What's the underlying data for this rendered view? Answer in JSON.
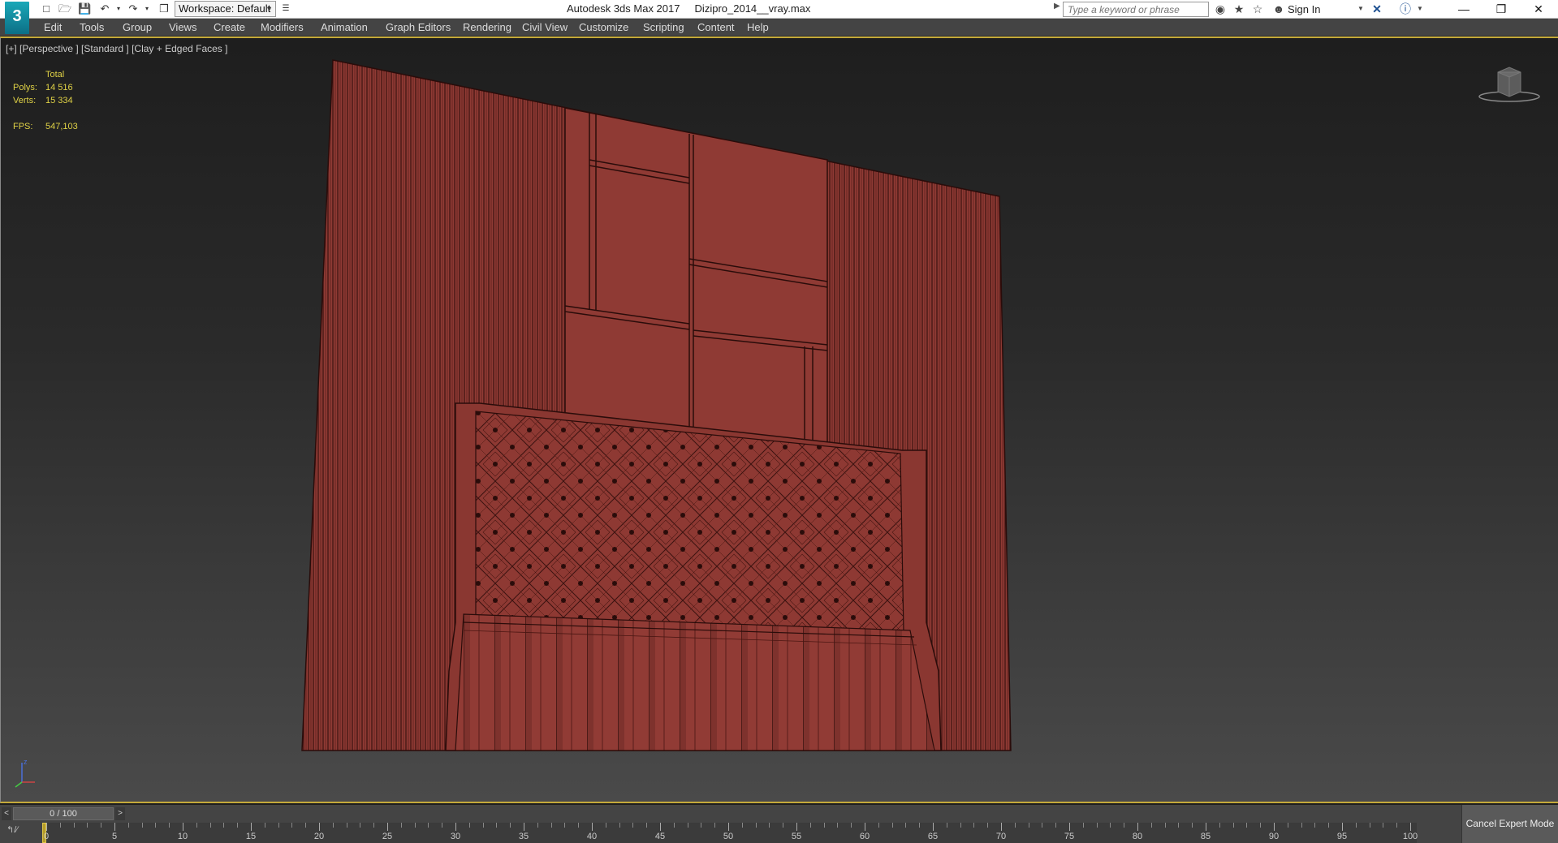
{
  "app": {
    "logo_text": "3",
    "title": "Autodesk 3ds Max 2017",
    "filename": "Dizipro_2014__vray.max",
    "workspace": "Workspace: Default"
  },
  "search": {
    "placeholder": "Type a keyword or phrase"
  },
  "user": {
    "signin": "Sign In"
  },
  "menu": [
    "Edit",
    "Tools",
    "Group",
    "Views",
    "Create",
    "Modifiers",
    "Animation",
    "Graph Editors",
    "Rendering",
    "Civil View",
    "Customize",
    "Scripting",
    "Content",
    "Help"
  ],
  "viewport": {
    "label": "[+] [Perspective ] [Standard ] [Clay + Edged Faces ]",
    "stats": {
      "header": "Total",
      "polys_label": "Polys:",
      "polys_value": "14 516",
      "verts_label": "Verts:",
      "verts_value": "15 334",
      "fps_label": "FPS:",
      "fps_value": "547,103"
    },
    "model_color": "#8f3a34",
    "wire_color": "#3a1210"
  },
  "timeslider": {
    "prev": "<",
    "position": "0 / 100",
    "next": ">",
    "current_frame": 0,
    "total_frames": 100
  },
  "timeline": {
    "labels": [
      "0",
      "5",
      "10",
      "15",
      "20",
      "25",
      "30",
      "35",
      "40",
      "45",
      "50",
      "55",
      "60",
      "65",
      "70",
      "75",
      "80",
      "85",
      "90",
      "95",
      "100"
    ]
  },
  "status": {
    "cancel_expert": "Cancel Expert Mode"
  },
  "colors": {
    "accent": "#c4a93a",
    "stats": "#e0d246",
    "menu_bg": "#444444"
  }
}
